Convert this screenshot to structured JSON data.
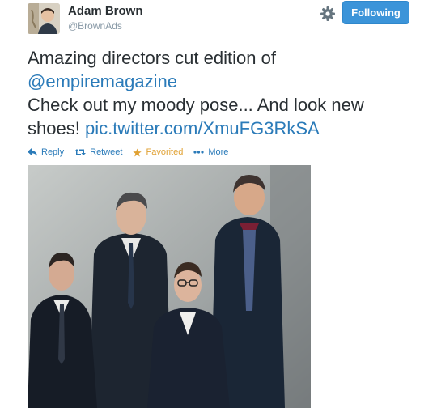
{
  "user": {
    "name": "Adam Brown",
    "handle": "@BrownAds"
  },
  "header": {
    "follow_label": "Following",
    "follow_color": "#3b94d9",
    "settings_icon": "gear-icon"
  },
  "tweet": {
    "text_1": "Amazing directors cut edition of",
    "mention": "@empiremagazine",
    "text_2": "Check out my moody pose... And look new shoes!",
    "link": "pic.twitter.com/XmuFG3RkSA",
    "link_color": "#2b7bb9"
  },
  "actions": [
    {
      "label": "Reply",
      "icon": "reply-icon"
    },
    {
      "label": "Retweet",
      "icon": "retweet-icon"
    },
    {
      "label": "Favorited",
      "icon": "star-icon",
      "color": "#e0a133"
    },
    {
      "label": "More",
      "icon": "more-dots-icon"
    }
  ],
  "photo": {
    "description_icon": "group-photo"
  }
}
